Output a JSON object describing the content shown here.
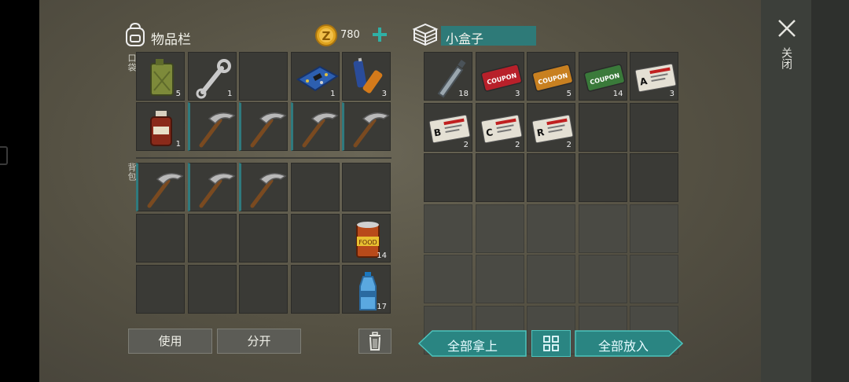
{
  "left_panel": {
    "title": "物品栏",
    "coins": "780",
    "pocket_label": "口袋",
    "backpack_label": "背包",
    "pocket_slots": [
      {
        "icon": "jerrycan-icon",
        "count": "5"
      },
      {
        "icon": "wrench-icon",
        "count": "1"
      },
      {
        "icon": "",
        "count": ""
      },
      {
        "icon": "circuit-board-icon",
        "count": "1"
      },
      {
        "icon": "battery-icon",
        "count": "3"
      },
      {
        "icon": "medicine-bottle-icon",
        "count": "1"
      },
      {
        "icon": "pickaxe-icon",
        "count": ""
      },
      {
        "icon": "pickaxe-icon",
        "count": ""
      },
      {
        "icon": "pickaxe-icon",
        "count": ""
      },
      {
        "icon": "pickaxe-icon",
        "count": ""
      }
    ],
    "backpack_slots": [
      {
        "icon": "pickaxe-icon",
        "count": ""
      },
      {
        "icon": "pickaxe-icon",
        "count": ""
      },
      {
        "icon": "pickaxe-icon",
        "count": ""
      },
      {
        "icon": "",
        "count": ""
      },
      {
        "icon": "",
        "count": ""
      },
      {
        "icon": "",
        "count": ""
      },
      {
        "icon": "",
        "count": ""
      },
      {
        "icon": "",
        "count": ""
      },
      {
        "icon": "",
        "count": ""
      },
      {
        "icon": "food-can-icon",
        "count": "14"
      },
      {
        "icon": "",
        "count": ""
      },
      {
        "icon": "",
        "count": ""
      },
      {
        "icon": "",
        "count": ""
      },
      {
        "icon": "",
        "count": ""
      },
      {
        "icon": "water-bottle-icon",
        "count": "17"
      }
    ],
    "buttons": {
      "use": "使用",
      "split": "分开"
    }
  },
  "right_panel": {
    "title": "小盒子",
    "slots": [
      {
        "icon": "empty-bottle-icon",
        "count": "18",
        "text": ""
      },
      {
        "icon": "coupon-red-icon",
        "count": "3",
        "text": "COUPON"
      },
      {
        "icon": "coupon-orange-icon",
        "count": "5",
        "text": "COUPON"
      },
      {
        "icon": "coupon-green-icon",
        "count": "14",
        "text": "COUPON"
      },
      {
        "icon": "ticket-a-icon",
        "count": "3",
        "text": "A"
      },
      {
        "icon": "ticket-b-icon",
        "count": "2",
        "text": "B"
      },
      {
        "icon": "ticket-c-icon",
        "count": "2",
        "text": "C"
      },
      {
        "icon": "ticket-r-icon",
        "count": "2",
        "text": "R"
      }
    ],
    "buttons": {
      "take_all": "全部拿上",
      "put_all": "全部放入"
    }
  },
  "close_label": "关闭",
  "colors": {
    "accent_teal": "#2e8c8a",
    "slot_bg": "#3a3a36",
    "bg": "#5a5648"
  }
}
